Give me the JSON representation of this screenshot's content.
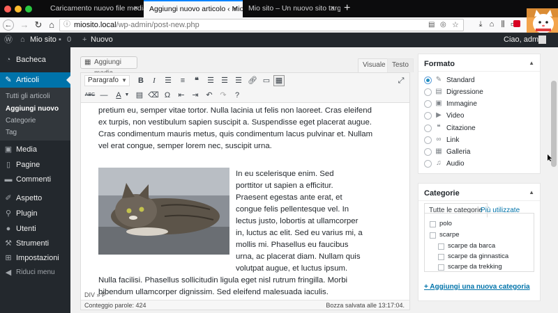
{
  "browser": {
    "tabs": [
      {
        "title": "Caricamento nuovo file media ‹ Mio sito — Wor",
        "active": false
      },
      {
        "title": "Aggiungi nuovo articolo ‹ Mio sito —",
        "active": true
      },
      {
        "title": "Mio sito – Un nuovo sito targato Wo",
        "active": false
      }
    ],
    "tab_close": "×",
    "new_tab": "+",
    "url_host": "miosito.local",
    "url_path": "/wp-admin/post-new.php"
  },
  "adminbar": {
    "site_name": "Mio sito",
    "comments_count": "0",
    "new_label": "Nuovo",
    "greeting": "Ciao, admin"
  },
  "sidebar": {
    "items": [
      {
        "label": "Bacheca",
        "icon": "dashboard-icon"
      },
      {
        "label": "Articoli",
        "icon": "pin-icon"
      },
      {
        "label": "Media",
        "icon": "media-icon"
      },
      {
        "label": "Pagine",
        "icon": "page-icon"
      },
      {
        "label": "Commenti",
        "icon": "comment-icon"
      },
      {
        "label": "Aspetto",
        "icon": "brush-icon"
      },
      {
        "label": "Plugin",
        "icon": "plugin-icon"
      },
      {
        "label": "Utenti",
        "icon": "user-icon"
      },
      {
        "label": "Strumenti",
        "icon": "wrench-icon"
      },
      {
        "label": "Impostazioni",
        "icon": "settings-icon"
      },
      {
        "label": "Riduci menu",
        "icon": "collapse-icon"
      }
    ],
    "submenu": [
      "Tutti gli articoli",
      "Aggiungi nuovo",
      "Categorie",
      "Tag"
    ]
  },
  "editor": {
    "add_media": "Aggiungi media",
    "tab_visual": "Visuale",
    "tab_text": "Testo",
    "format_select": "Paragrafo",
    "paragraph1": [
      "pretium eu, semper vitae tortor. Nulla lacinia ut felis non laoreet. Cras eleifend",
      "ex turpis, non vestibulum sapien suscipit a. Suspendisse eget placerat augue.",
      "Cras condimentum mauris metus, quis condimentum lacus pulvinar et. Nullam",
      "vel erat congue, semper lorem nec, suscipit urna."
    ],
    "paragraph2": [
      "In eu scelerisque enim. Sed",
      "porttitor ut sapien a efficitur.",
      "Praesent egestas ante erat, et",
      "congue felis pellentesque vel. In",
      "lectus justo, lobortis at ullamcorper",
      "in, luctus ac elit. Sed eu varius mi, a",
      "mollis mi. Phasellus eu faucibus",
      "urna, ac placerat diam. Nullam quis",
      "volutpat augue, et luctus ipsum."
    ],
    "paragraph3": [
      "Nulla facilisi. Phasellus sollicitudin ligula eget nisl rutrum fringilla. Morbi",
      "bibendum ullamcorper dignissim. Sed eleifend malesuada iaculis."
    ],
    "path": "DIV » P",
    "word_count": "Conteggio parole: 424",
    "draft_saved": "Bozza salvata alle 13:17:04."
  },
  "format_box": {
    "title": "Formato",
    "options": [
      {
        "label": "Standard",
        "icon": "pin-icon",
        "selected": true
      },
      {
        "label": "Digressione",
        "icon": "aside-icon",
        "selected": false
      },
      {
        "label": "Immagine",
        "icon": "image-icon",
        "selected": false
      },
      {
        "label": "Video",
        "icon": "video-icon",
        "selected": false
      },
      {
        "label": "Citazione",
        "icon": "quote-icon",
        "selected": false
      },
      {
        "label": "Link",
        "icon": "link-icon",
        "selected": false
      },
      {
        "label": "Galleria",
        "icon": "gallery-icon",
        "selected": false
      },
      {
        "label": "Audio",
        "icon": "audio-icon",
        "selected": false
      }
    ]
  },
  "categories_box": {
    "title": "Categorie",
    "tab_all": "Tutte le categorie",
    "tab_popular": "Più utilizzate",
    "items": [
      {
        "label": "polo",
        "level": 0
      },
      {
        "label": "scarpe",
        "level": 0
      },
      {
        "label": "scarpe da barca",
        "level": 1
      },
      {
        "label": "scarpe da ginnastica",
        "level": 1
      },
      {
        "label": "scarpe da trekking",
        "level": 1
      }
    ],
    "add_link": "+ Aggiungi una nuova categoria"
  },
  "colors": {
    "admin_dark": "#23282d",
    "admin_blue": "#0073aa",
    "link": "#0073aa"
  }
}
